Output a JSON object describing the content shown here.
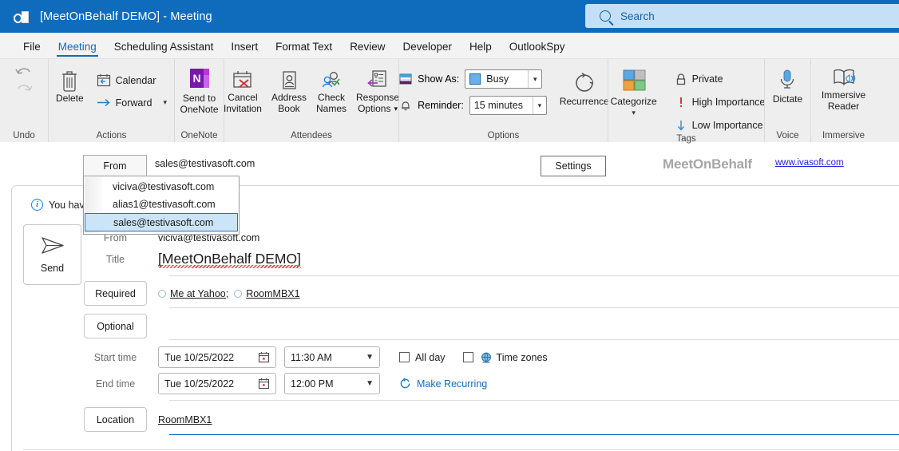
{
  "window": {
    "title": "[MeetOnBehalf DEMO]  -  Meeting",
    "app_icon": "outlook-icon"
  },
  "search": {
    "placeholder": "Search",
    "icon": "search-icon"
  },
  "tabs": [
    {
      "label": "File",
      "active": false
    },
    {
      "label": "Meeting",
      "active": true
    },
    {
      "label": "Scheduling Assistant",
      "active": false
    },
    {
      "label": "Insert",
      "active": false
    },
    {
      "label": "Format Text",
      "active": false
    },
    {
      "label": "Review",
      "active": false
    },
    {
      "label": "Developer",
      "active": false
    },
    {
      "label": "Help",
      "active": false
    },
    {
      "label": "OutlookSpy",
      "active": false
    }
  ],
  "ribbon": {
    "groups": {
      "undo": {
        "label": "Undo",
        "undo_icon": "undo-arrow-icon",
        "redo_icon": "redo-arrow-icon"
      },
      "actions": {
        "label": "Actions",
        "delete_label": "Delete",
        "calendar_label": "Calendar",
        "forward_label": "Forward"
      },
      "onenote": {
        "label": "OneNote",
        "send_line1": "Send to",
        "send_line2": "OneNote"
      },
      "attendees": {
        "label": "Attendees",
        "cancel_line1": "Cancel",
        "cancel_line2": "Invitation",
        "address_line1": "Address",
        "address_line2": "Book",
        "check_line1": "Check",
        "check_line2": "Names",
        "response_line1": "Response",
        "response_line2": "Options"
      },
      "options": {
        "label": "Options",
        "show_as_label": "Show As:",
        "show_as_value": "Busy",
        "reminder_label": "Reminder:",
        "reminder_value": "15 minutes",
        "recurrence_label": "Recurrence"
      },
      "tags": {
        "label": "Tags",
        "categorize_label": "Categorize",
        "private_label": "Private",
        "high_importance_label": "High Importance",
        "low_importance_label": "Low Importance"
      },
      "voice": {
        "label": "Voice",
        "dictate_label": "Dictate"
      },
      "immersive": {
        "label": "Immersive",
        "reader_line1": "Immersive",
        "reader_line2": "Reader"
      }
    }
  },
  "addon": {
    "from_button_label": "From",
    "from_button_value": "sales@testivasoft.com",
    "settings_label": "Settings",
    "brand": "MeetOnBehalf",
    "brand_link": "www.ivasoft.com",
    "dropdown": {
      "items": [
        {
          "label": "viciva@testivasoft.com",
          "selected": false
        },
        {
          "label": "alias1@testivasoft.com",
          "selected": false
        },
        {
          "label": "sales@testivasoft.com",
          "selected": true
        }
      ]
    }
  },
  "form": {
    "infobar_text": "You haven't",
    "send_label": "Send",
    "from_label": "From",
    "from_value": "viciva@testivasoft.com",
    "title_label": "Title",
    "title_value": "[MeetOnBehalf DEMO]",
    "required_label": "Required",
    "required_attendees": [
      {
        "name": "Me at Yahoo;"
      },
      {
        "name": "RoomMBX1"
      }
    ],
    "optional_label": "Optional",
    "optional_value": "",
    "start_time_label": "Start time",
    "start_date_value": "Tue 10/25/2022",
    "start_time_value": "11:30 AM",
    "end_time_label": "End time",
    "end_date_value": "Tue 10/25/2022",
    "end_time_value": "12:00 PM",
    "all_day_label": "All day",
    "time_zones_label": "Time zones",
    "make_recurring_label": "Make Recurring",
    "location_label": "Location",
    "location_value": "RoomMBX1"
  },
  "colors": {
    "titlebar": "#0f6cbd",
    "accent": "#0f6cbd",
    "ribbon_bg": "#eeeeee",
    "selection": "#cce4f7",
    "brand_gray": "#a6a6a6",
    "link_blue": "#2222dd"
  }
}
